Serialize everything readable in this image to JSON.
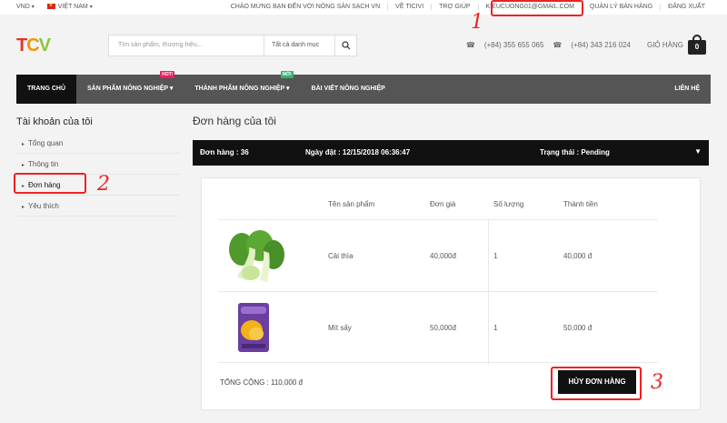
{
  "topbar": {
    "currency": "VND",
    "language": "VIỆT NAM",
    "welcome": "CHÀO MỪNG BẠN ĐẾN VỚI NÔNG SẢN SẠCH VN",
    "about": "VỀ TICIVI",
    "help": "TRỢ GIÚP",
    "email": "KIEUCUONG01@GMAIL.COM",
    "manage": "QUẢN LÝ BÁN HÀNG",
    "logout": "ĐĂNG XUẤT"
  },
  "header": {
    "logo": [
      "T",
      "C",
      "V",
      ""
    ],
    "search_placeholder": "Tìm sản phẩm, thương hiệu...",
    "category": "Tất cả danh mục",
    "phone1": "(+84) 355 655 065",
    "phone2": "(+84) 343 216 024",
    "cart_label": "GIỎ HÀNG",
    "cart_count": "0"
  },
  "nav": {
    "home": "TRANG CHỦ",
    "products": "SẢN PHẨM NÔNG NGHIỆP",
    "products_badge": "HOT!",
    "finished": "THÀNH PHẨM NÔNG NGHIỆP",
    "finished_badge": "MỚI",
    "articles": "BÀI VIẾT NÔNG NGHIỆP",
    "contact": "LIÊN HỆ"
  },
  "sidebar": {
    "title": "Tài khoản của tôi",
    "items": [
      "Tổng quan",
      "Thông tin",
      "Đơn hàng",
      "Yêu thích"
    ]
  },
  "main": {
    "title": "Đơn hàng của tôi",
    "order_no": "Đơn hàng : 36",
    "order_date": "Ngày đặt : 12/15/2018 06:36:47",
    "status": "Trạng thái : Pending",
    "columns": [
      "Tên sản phẩm",
      "Đơn giá",
      "Số lượng",
      "Thành tiền"
    ],
    "rows": [
      {
        "name": "Cải thìa",
        "price": "40,000đ",
        "qty": "1",
        "total": "40,000 đ"
      },
      {
        "name": "Mít sấy",
        "price": "50,000đ",
        "qty": "1",
        "total": "50,000 đ"
      }
    ],
    "total": "TỔNG CỘNG : 110,000 đ",
    "cancel": "HỦY ĐƠN HÀNG"
  },
  "annotations": [
    "1",
    "2",
    "3"
  ],
  "colors": {
    "annotation": "#e22222",
    "nav": "#555555",
    "order_bar": "#111111"
  }
}
